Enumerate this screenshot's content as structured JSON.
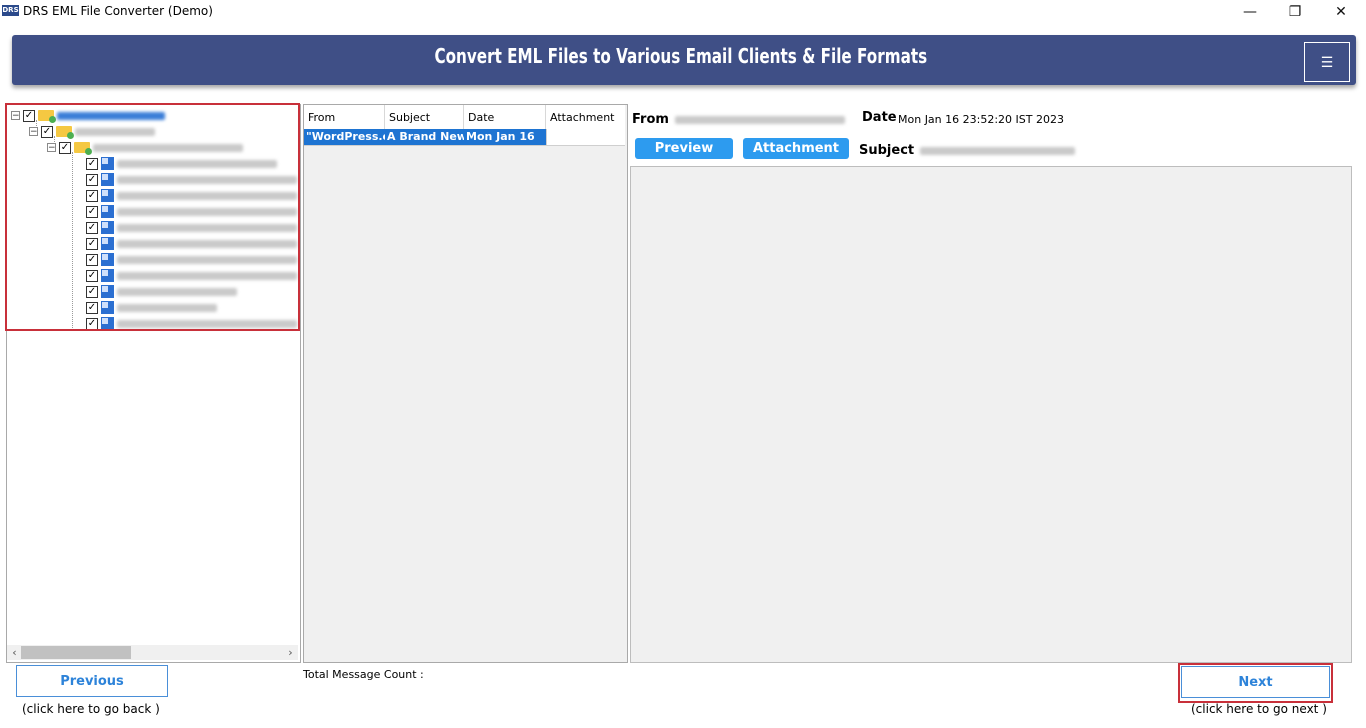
{
  "window": {
    "logo_text": "DRS",
    "title": "DRS EML File Converter (Demo)",
    "controls": {
      "minimize": "—",
      "restore": "❐",
      "close": "✕"
    }
  },
  "banner": {
    "title": "Convert EML Files to Various Email Clients & File Formats",
    "menu_icon": "☰"
  },
  "tree": {
    "expander_symbol": "−",
    "check_symbol": "✓",
    "scroll_left": "‹",
    "scroll_right": "›"
  },
  "message_list": {
    "columns": [
      "From",
      "Subject",
      "Date",
      "Attachment"
    ],
    "rows": [
      {
        "from": "\"WordPress.co",
        "subject": "A Brand New",
        "date": "Mon Jan 16",
        "attachment": ""
      }
    ]
  },
  "preview": {
    "from_label": "From",
    "date_label": "Date",
    "date_value": "Mon Jan 16 23:52:20 IST 2023",
    "subject_label": "Subject",
    "preview_button": "Preview",
    "attachment_button": "Attachment"
  },
  "footer": {
    "previous_label": "Previous",
    "previous_hint": "(click here to  go back )",
    "next_label": "Next",
    "next_hint": "(click here to  go next )",
    "total_count_label": "Total Message Count :"
  },
  "colors": {
    "banner": "#3f4f86",
    "accent": "#2d9bef",
    "selection": "#1e74d2",
    "highlight_border": "#c8303a"
  }
}
